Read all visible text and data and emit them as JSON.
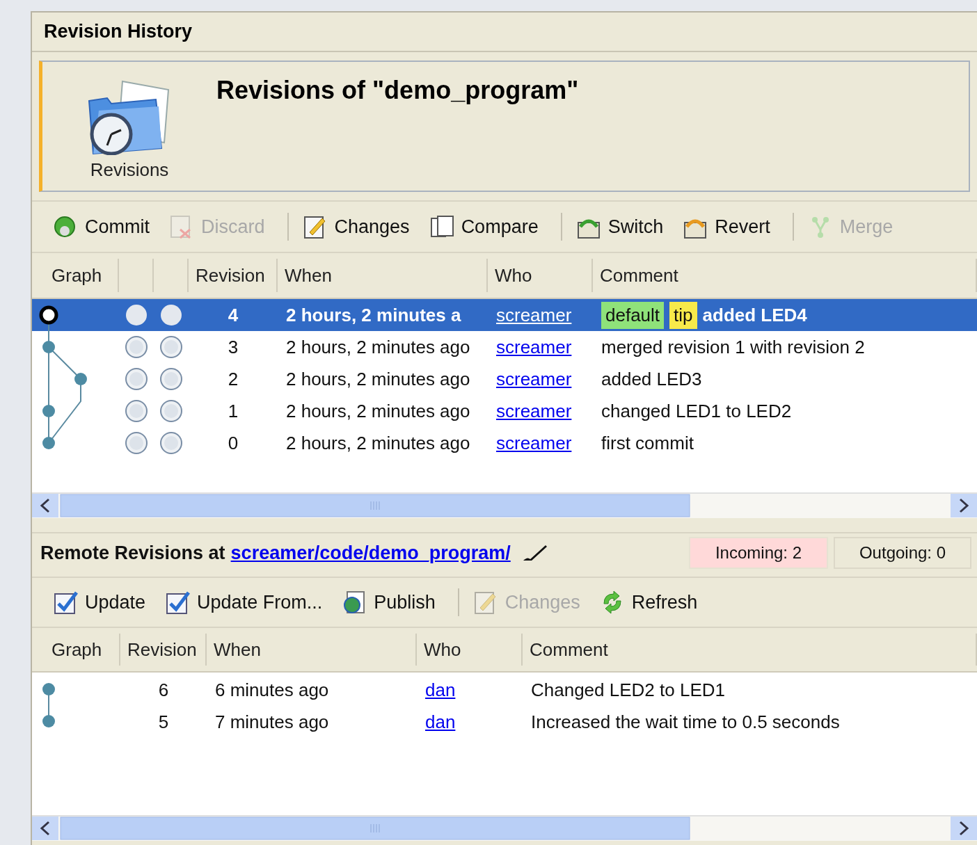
{
  "panel_title": "Revision History",
  "header": {
    "icon_label": "Revisions",
    "title": "Revisions of \"demo_program\""
  },
  "local_toolbar": {
    "groups": [
      [
        {
          "label": "Commit",
          "disabled": false
        },
        {
          "label": "Discard",
          "disabled": true
        }
      ],
      [
        {
          "label": "Changes",
          "disabled": false
        },
        {
          "label": "Compare",
          "disabled": false
        }
      ],
      [
        {
          "label": "Switch",
          "disabled": false
        },
        {
          "label": "Revert",
          "disabled": false
        }
      ],
      [
        {
          "label": "Merge",
          "disabled": true
        }
      ]
    ]
  },
  "local_table": {
    "columns": [
      "Graph",
      "",
      "",
      "Revision",
      "When",
      "Who",
      "Comment"
    ],
    "rows": [
      {
        "selected": true,
        "revision": "4",
        "when": "2 hours, 2 minutes a",
        "who": "screamer",
        "tags": [
          {
            "label": "default",
            "color": "#8fe27a"
          },
          {
            "label": "tip",
            "color": "#f7ea4a"
          }
        ],
        "comment": "added LED4"
      },
      {
        "selected": false,
        "revision": "3",
        "when": "2 hours, 2 minutes ago",
        "who": "screamer",
        "comment": "merged revision 1 with revision 2"
      },
      {
        "selected": false,
        "revision": "2",
        "when": "2 hours, 2 minutes ago",
        "who": "screamer",
        "comment": "added LED3"
      },
      {
        "selected": false,
        "revision": "1",
        "when": "2 hours, 2 minutes ago",
        "who": "screamer",
        "comment": "changed LED1 to LED2"
      },
      {
        "selected": false,
        "revision": "0",
        "when": "2 hours, 2 minutes ago",
        "who": "screamer",
        "comment": "first commit"
      }
    ]
  },
  "remote": {
    "label": "Remote Revisions at",
    "link": "screamer/code/demo_program/",
    "incoming": "Incoming: 2",
    "outgoing": "Outgoing: 0"
  },
  "remote_toolbar": {
    "groups": [
      [
        {
          "label": "Update",
          "disabled": false
        },
        {
          "label": "Update From...",
          "disabled": false
        },
        {
          "label": "Publish",
          "disabled": false
        }
      ],
      [
        {
          "label": "Changes",
          "disabled": true
        },
        {
          "label": "Refresh",
          "disabled": false
        }
      ]
    ]
  },
  "remote_table": {
    "columns": [
      "Graph",
      "Revision",
      "When",
      "Who",
      "Comment"
    ],
    "rows": [
      {
        "revision": "6",
        "when": "6 minutes ago",
        "who": "dan",
        "comment": "Changed LED2 to LED1"
      },
      {
        "revision": "5",
        "when": "7 minutes ago",
        "who": "dan",
        "comment": "Increased the wait time to 0.5 seconds"
      }
    ]
  }
}
